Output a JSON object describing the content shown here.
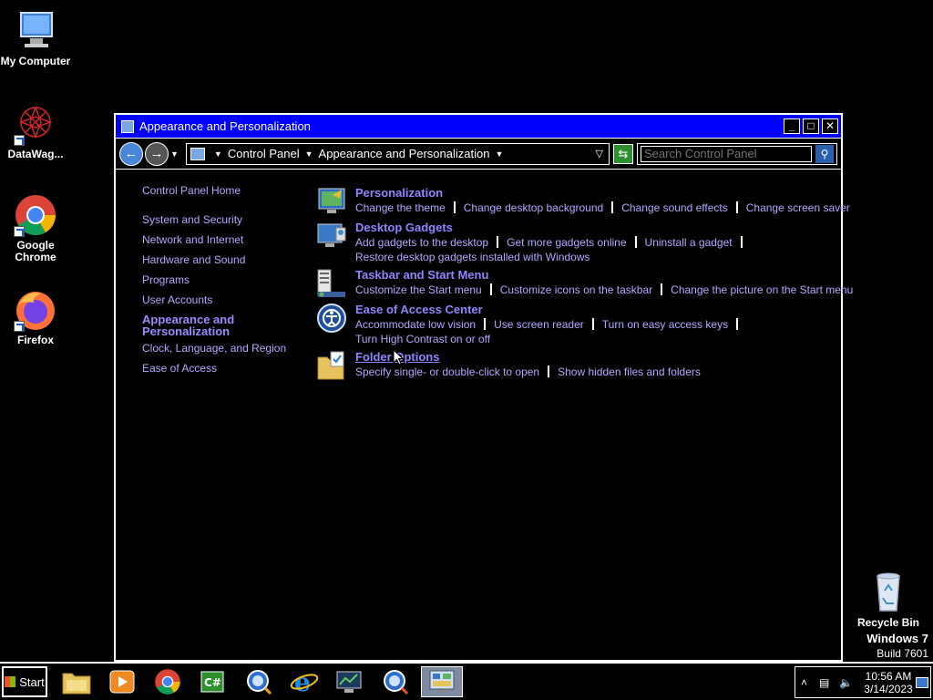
{
  "desktop": {
    "icons": [
      {
        "label": "My Computer"
      },
      {
        "label": "DataWag..."
      },
      {
        "label": "Google Chrome"
      },
      {
        "label": "Firefox"
      },
      {
        "label": "Recycle Bin"
      }
    ],
    "watermark": {
      "line1": "Windows 7",
      "line2": "Build 7601"
    }
  },
  "window": {
    "title": "Appearance and Personalization",
    "buttons": {
      "minimize": "_",
      "maximize": "□",
      "close": "✕"
    },
    "breadcrumb": [
      "Control Panel",
      "Appearance and Personalization"
    ],
    "search_placeholder": "Search Control Panel"
  },
  "left_nav": {
    "items": [
      "Control Panel Home",
      "System and Security",
      "Network and Internet",
      "Hardware and Sound",
      "Programs",
      "User Accounts",
      "Appearance and Personalization",
      "Clock, Language, and Region",
      "Ease of Access"
    ]
  },
  "categories": [
    {
      "heading": "Personalization",
      "links": [
        "Change the theme",
        "Change desktop background",
        "Change sound effects",
        "Change screen saver"
      ]
    },
    {
      "heading": "Desktop Gadgets",
      "links": [
        "Add gadgets to the desktop",
        "Get more gadgets online",
        "Uninstall a gadget",
        "Restore desktop gadgets installed with Windows"
      ]
    },
    {
      "heading": "Taskbar and Start Menu",
      "links": [
        "Customize the Start menu",
        "Customize icons on the taskbar",
        "Change the picture on the Start menu"
      ]
    },
    {
      "heading": "Ease of Access Center",
      "links": [
        "Accommodate low vision",
        "Use screen reader",
        "Turn on easy access keys",
        "Turn High Contrast on or off"
      ]
    },
    {
      "heading": "Folder Options",
      "links": [
        "Specify single- or double-click to open",
        "Show hidden files and folders"
      ]
    }
  ],
  "taskbar": {
    "start_label": "Start",
    "clock_time": "10:56 AM",
    "clock_date": "3/14/2023"
  }
}
